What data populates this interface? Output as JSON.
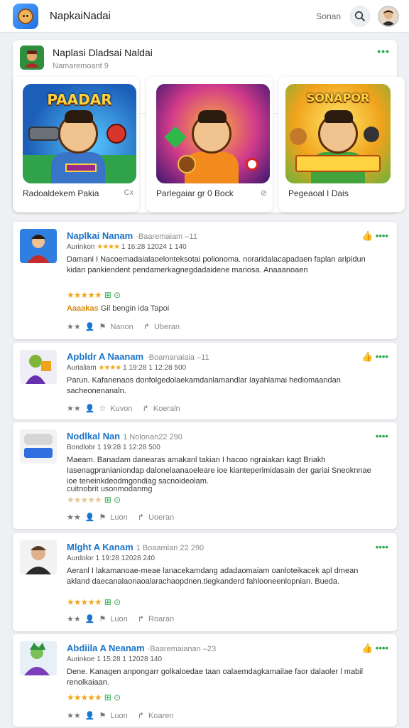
{
  "app": {
    "title": "NapkaiNadai",
    "section_label": "Sonan",
    "colors": {
      "accent": "#1a73c8",
      "green": "#2aa84a",
      "star": "#f0a81c"
    }
  },
  "featured": {
    "title": "Naplasi Dladsai Naldai",
    "subtitle": "Namaremoant 9",
    "more": "•••",
    "games": [
      {
        "logo": "PAADAR",
        "label": "Radoaldekem Pakia",
        "icon": "Cx"
      },
      {
        "logo": "",
        "label": "Parlegaiar gr 0 Bock",
        "icon": "⊘"
      },
      {
        "logo": "SONAPOR",
        "label": "Pegeaoal I Dais",
        "icon": ""
      }
    ]
  },
  "reviews": [
    {
      "name": "Naplkai Nanam",
      "meta": "·Baaremaiam –11",
      "sub_label": "Aurinkon",
      "sub_stars": "★★★★",
      "sub_meta": "1 16:28 12024 1 140",
      "body": "Damani I Nacoemadaialaoelonteksotai polionoma. noraridalacapadaen faplan aripidun kidan pankiendent pendamerkagnegdadaidene mariosa. Anaaanoaen",
      "rating": "★★★★★",
      "rating_icons": "⊞ ⊙",
      "note_hl": "Aaaakas",
      "note": "Gil bengin ida Tapoi",
      "act1": "Nanon",
      "act2": "Uberan"
    },
    {
      "name": "Apbldr A Naanam",
      "meta": "·Boamanaiaia –11",
      "sub_label": "Aurialiam",
      "sub_stars": "★★★★",
      "sub_meta": "1 19:28 1 12:28 500",
      "body": "Parun. Kafanenaos donfolgedolaekamdanlamandlar Iayahlamai hediomaandan sacheonenanaln.",
      "rating": "",
      "rating_icons": "",
      "note_hl": "",
      "note": "",
      "act1": "Kuvon",
      "act2": "Koeraln"
    },
    {
      "name": "Nodlkal Nan",
      "meta": "1 Nolonan22 290",
      "sub_label": "Bondlobr",
      "sub_stars": "",
      "sub_meta": "1 19:28 1 12:28 500",
      "body": "Maeam. Banadam danearas amakanl takian I hacoo ngraiakan kagt Briakh Iasenagpranianiondap dalonelaanaoeleare ioe kianteperimidasain der gariai Sneoknnae ioe teneinkdeodmgondiag sacnoideolam.",
      "rating": "★★★★★",
      "rating_icons": "⊞ ⊙",
      "note_hl": "",
      "note": "cuitnobrit usonmodanmg",
      "act1": "Luon",
      "act2": "Uoeran"
    },
    {
      "name": "Mlght A Kanam",
      "meta": "1 Boaamlan 22 290",
      "sub_label": "Aurdolor",
      "sub_stars": "",
      "sub_meta": "1 19:28 12028 240",
      "body": "Aeranl I lakamanoae-meae lanacekamdang adadaomaiam oanloteikacek apl dmean akland daecanalaonaoalarachaopdnen.tiegkanderd fahlooneenlopnian. Bueda.",
      "rating": "★★★★★",
      "rating_icons": "⊞ ⊙",
      "note_hl": "",
      "note": "",
      "act1": "Luon",
      "act2": "Roaran"
    },
    {
      "name": "Abdiila A Neanam",
      "meta": "·Baaremaianan –23",
      "sub_label": "Aurinkoe",
      "sub_stars": "",
      "sub_meta": "1 15:28 1 12028 140",
      "body": "Dene. Kanagen anpongarr golkaloedae taan oalaemdagkamailae faor dalaoler l mabil renolkaiaan.",
      "rating": "★★★★★",
      "rating_icons": "⊞ ⊙",
      "note_hl": "",
      "note": "",
      "act1": "Luon",
      "act2": "Koaren"
    }
  ]
}
